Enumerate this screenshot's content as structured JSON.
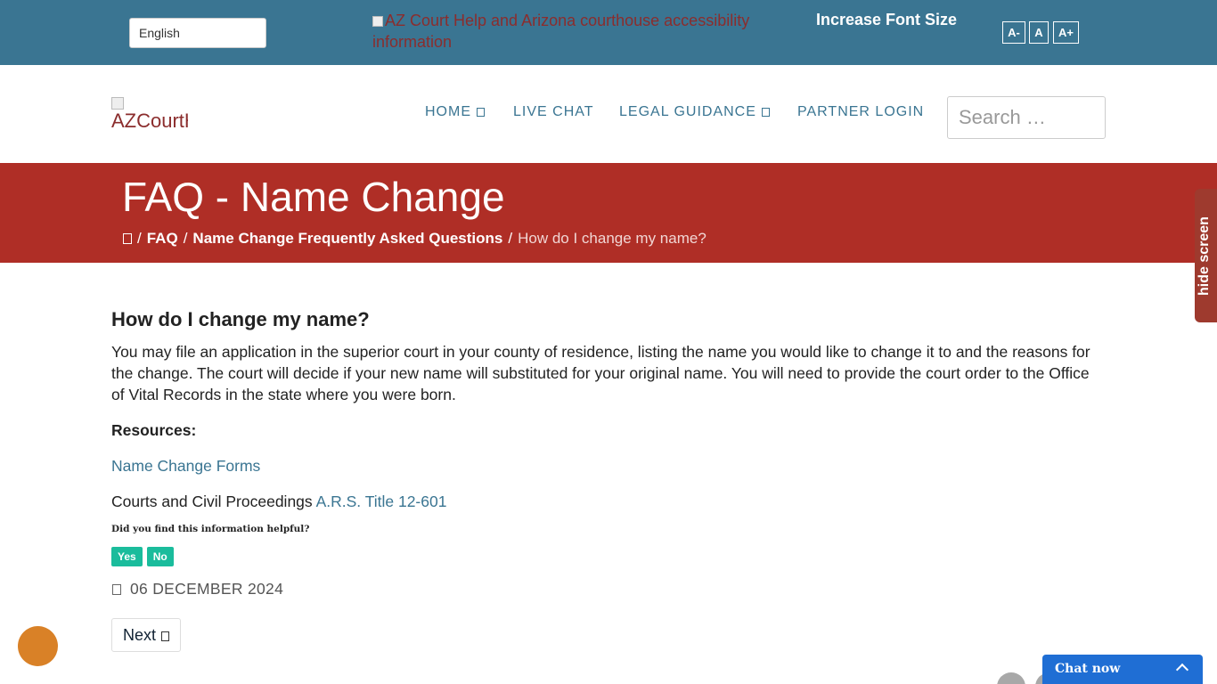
{
  "topbar": {
    "language": "English",
    "banner_image_alt": "AZ Court Help and Arizona courthouse accessibility information",
    "font_size_label": "Increase Font Size",
    "font_buttons": [
      "A-",
      "A",
      "A+"
    ],
    "background_color": "#3a7592"
  },
  "header": {
    "logo_alt": "AZCourtHelp",
    "nav": [
      {
        "label": "HOME",
        "dropdown": true
      },
      {
        "label": "LIVE CHAT",
        "dropdown": false
      },
      {
        "label": "LEGAL GUIDANCE",
        "dropdown": true
      },
      {
        "label": "PARTNER LOGIN",
        "dropdown": false
      }
    ],
    "search_placeholder": "Search …"
  },
  "banner": {
    "title": "FAQ - Name Change",
    "breadcrumb": [
      "home-icon",
      "FAQ",
      "Name Change Frequently Asked Questions",
      "How do I change my name?"
    ],
    "background_color": "#af2e26"
  },
  "side_tab": {
    "label": "hide screen"
  },
  "article": {
    "question": "How do I change my name?",
    "answer": "You may file an application in the superior court in your county of residence, listing the name you would like to change it to and the reasons for the change. The court will decide if your new name will substituted for your original name. You will need to provide the court order to the Office of Vital Records in the state where you were born.",
    "resources_label": "Resources:",
    "forms_link": "Name Change Forms",
    "civil_text": "Courts and Civil Proceedings",
    "civil_link": "A.R.S. Title 12-601",
    "helpful_question": "Did you find this information helpful?",
    "vote_yes": "Yes",
    "vote_no": "No",
    "date": "06 DECEMBER 2024",
    "next_label": "Next"
  },
  "chat_widget": {
    "label": "Chat now",
    "color": "#1f6ed4"
  }
}
